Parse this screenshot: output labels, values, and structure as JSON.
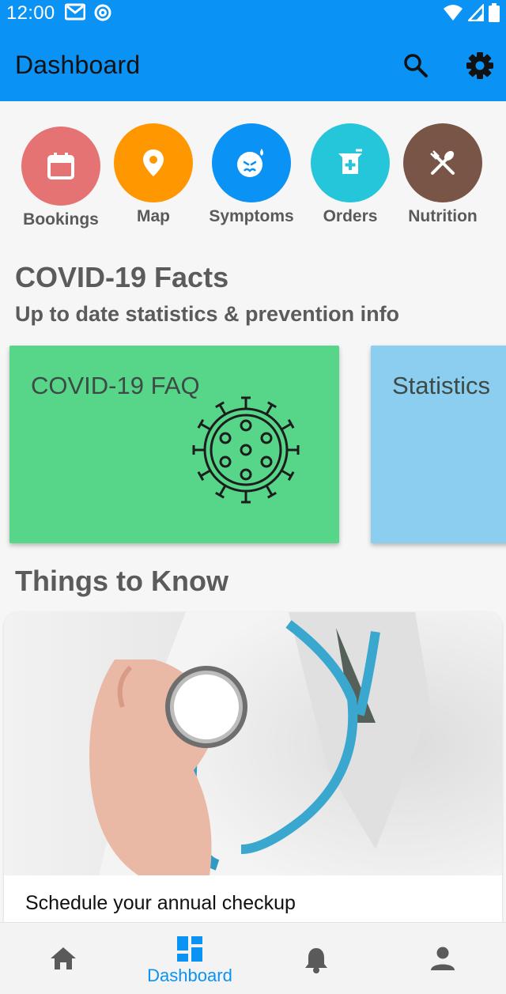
{
  "status_bar": {
    "time": "12:00"
  },
  "app_bar": {
    "title": "Dashboard"
  },
  "quick_actions": [
    {
      "label": "Bookings",
      "color": "#e57373",
      "icon": "calendar-icon"
    },
    {
      "label": "Map",
      "color": "#ff9800",
      "icon": "location-pin-icon"
    },
    {
      "label": "Symptoms",
      "color": "#0a92f4",
      "icon": "sick-face-icon"
    },
    {
      "label": "Orders",
      "color": "#26c6da",
      "icon": "pharmacy-icon"
    },
    {
      "label": "Nutrition",
      "color": "#795548",
      "icon": "utensils-icon"
    }
  ],
  "facts": {
    "title": "COVID-19 Facts",
    "subtitle": "Up to date statistics & prevention info",
    "cards": [
      {
        "title": "COVID-19 FAQ",
        "color": "#57d68a",
        "icon": "virus-icon"
      },
      {
        "title": "Statistics",
        "color": "#8bcef0"
      }
    ]
  },
  "things_to_know": {
    "title": "Things to Know",
    "card_caption": "Schedule your annual checkup"
  },
  "bottom_nav": {
    "items": [
      {
        "icon": "home-icon",
        "label": ""
      },
      {
        "icon": "dashboard-icon",
        "label": "Dashboard",
        "active": true
      },
      {
        "icon": "bell-icon",
        "label": ""
      },
      {
        "icon": "person-icon",
        "label": ""
      }
    ]
  },
  "colors": {
    "primary": "#0a92f4",
    "heading_gray": "#5b5b5b"
  }
}
